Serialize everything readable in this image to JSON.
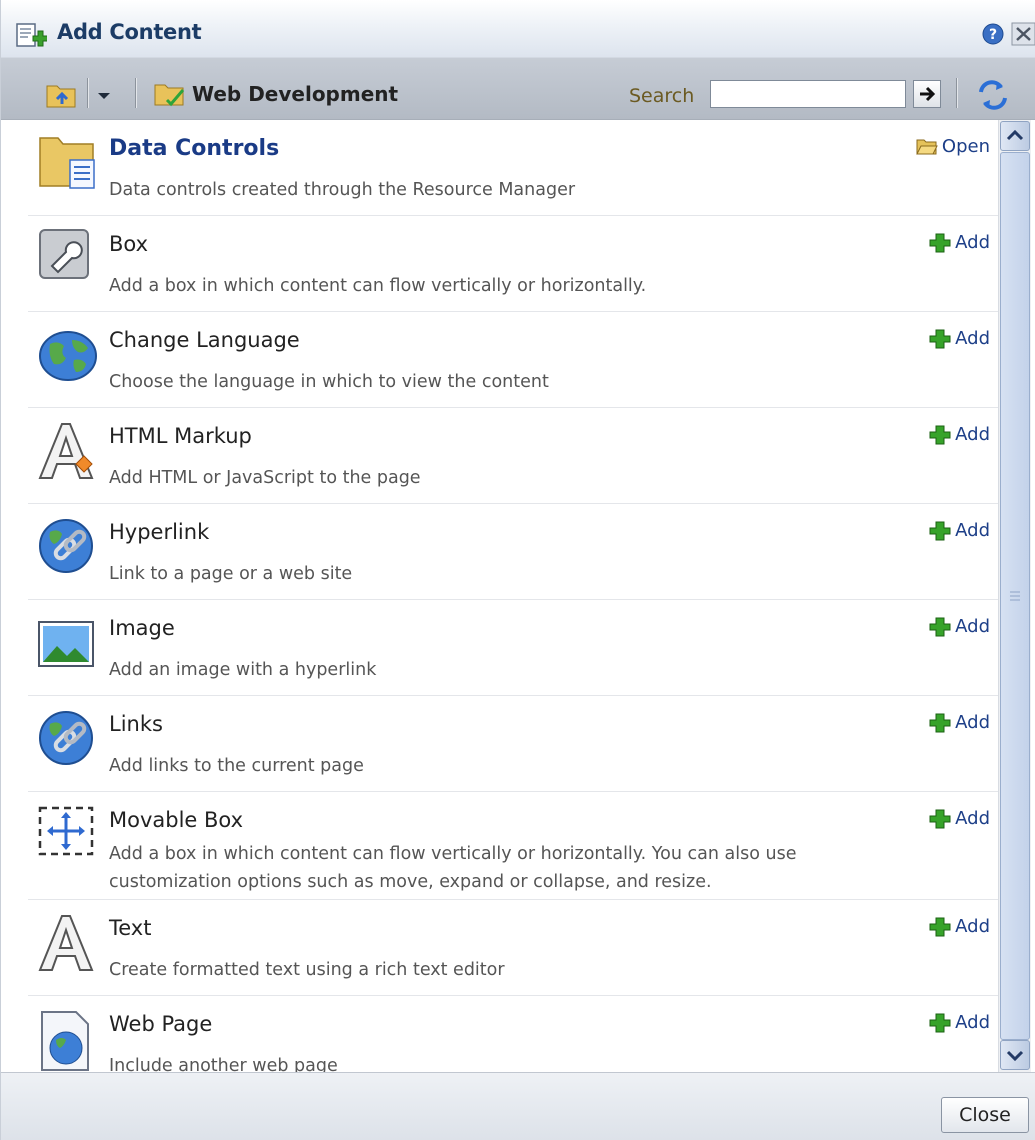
{
  "dialog": {
    "title": "Add Content"
  },
  "toolbar": {
    "folder_name": "Web Development",
    "search_label": "Search",
    "search_value": ""
  },
  "items": [
    {
      "title": "Data Controls",
      "desc": "Data controls created through the Resource Manager",
      "action": "Open",
      "icon": "folder-icon",
      "kind": "folder"
    },
    {
      "title": "Box",
      "desc": "Add a box in which content can flow vertically or horizontally.",
      "action": "Add",
      "icon": "wrench-box-icon"
    },
    {
      "title": "Change Language",
      "desc": "Choose the language in which to view the content",
      "action": "Add",
      "icon": "globe-icon"
    },
    {
      "title": "HTML Markup",
      "desc": "Add HTML or JavaScript to the page",
      "action": "Add",
      "icon": "html-markup-icon"
    },
    {
      "title": "Hyperlink",
      "desc": "Link to a page or a web site",
      "action": "Add",
      "icon": "hyperlink-icon"
    },
    {
      "title": "Image",
      "desc": "Add an image with a hyperlink",
      "action": "Add",
      "icon": "image-icon"
    },
    {
      "title": "Links",
      "desc": "Add links to the current page",
      "action": "Add",
      "icon": "links-icon"
    },
    {
      "title": "Movable Box",
      "desc": "Add a box in which content can flow vertically or horizontally. You can also use customization options such as move, expand or collapse, and resize.",
      "action": "Add",
      "icon": "movable-box-icon"
    },
    {
      "title": "Text",
      "desc": "Create formatted text using a rich text editor",
      "action": "Add",
      "icon": "text-icon"
    },
    {
      "title": "Web Page",
      "desc": "Include another web page",
      "action": "Add",
      "icon": "web-page-icon"
    }
  ],
  "footer": {
    "close_label": "Close"
  }
}
